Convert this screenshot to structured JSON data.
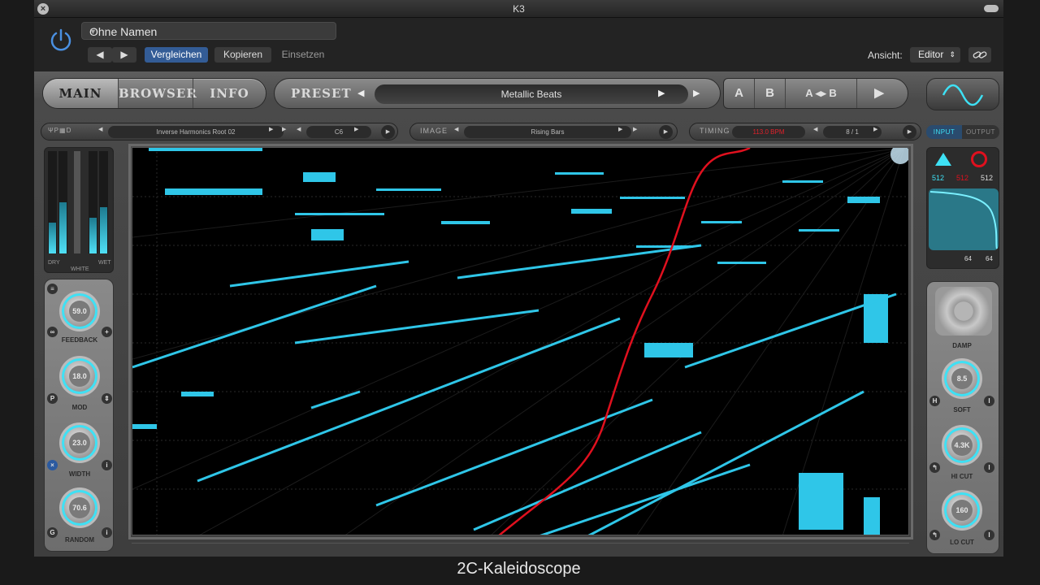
{
  "window": {
    "title": "K3"
  },
  "host": {
    "preset_name": "Ohne Namen",
    "compare_label": "Vergleichen",
    "copy_label": "Kopieren",
    "paste_label": "Einsetzen",
    "view_label": "Ansicht:",
    "view_value": "Editor"
  },
  "tabs": {
    "main": "MAIN",
    "browser": "BROWSER",
    "info": "INFO"
  },
  "preset": {
    "label": "PRESET",
    "name": "Metallic Beats",
    "a": "A",
    "b": "B",
    "ab_copy": "A ◂▸ B"
  },
  "params": {
    "source_name": "Inverse Harmonics Root 02",
    "note": "C6",
    "image_label": "IMAGE",
    "image_name": "Rising Bars",
    "timing_label": "TIMING",
    "timing_value": "113.0 BPM",
    "division": "8 / 1"
  },
  "mix": {
    "dry": "DRY",
    "wet": "WET",
    "white": "WHITE"
  },
  "left_knobs": [
    {
      "label": "FEEDBACK",
      "value": "59.0"
    },
    {
      "label": "MOD",
      "value": "18.0"
    },
    {
      "label": "WIDTH",
      "value": "23.0"
    },
    {
      "label": "RANDOM",
      "value": "70.6"
    }
  ],
  "io": {
    "input": "INPUT",
    "output": "OUTPUT",
    "res_1": "512",
    "res_2": "512",
    "res_3": "512",
    "val_a": "64",
    "val_b": "64"
  },
  "right_knobs": [
    {
      "label": "DAMP",
      "value": ""
    },
    {
      "label": "SOFT",
      "value": "8.5"
    },
    {
      "label": "HI CUT",
      "value": "4.3K"
    },
    {
      "label": "LO CUT",
      "value": "160"
    }
  ],
  "footer": {
    "caption": "2C-Kaleidoscope"
  },
  "colors": {
    "accent": "#3ee1f5",
    "curve": "#e0101e",
    "active_tab": "#335c96"
  }
}
